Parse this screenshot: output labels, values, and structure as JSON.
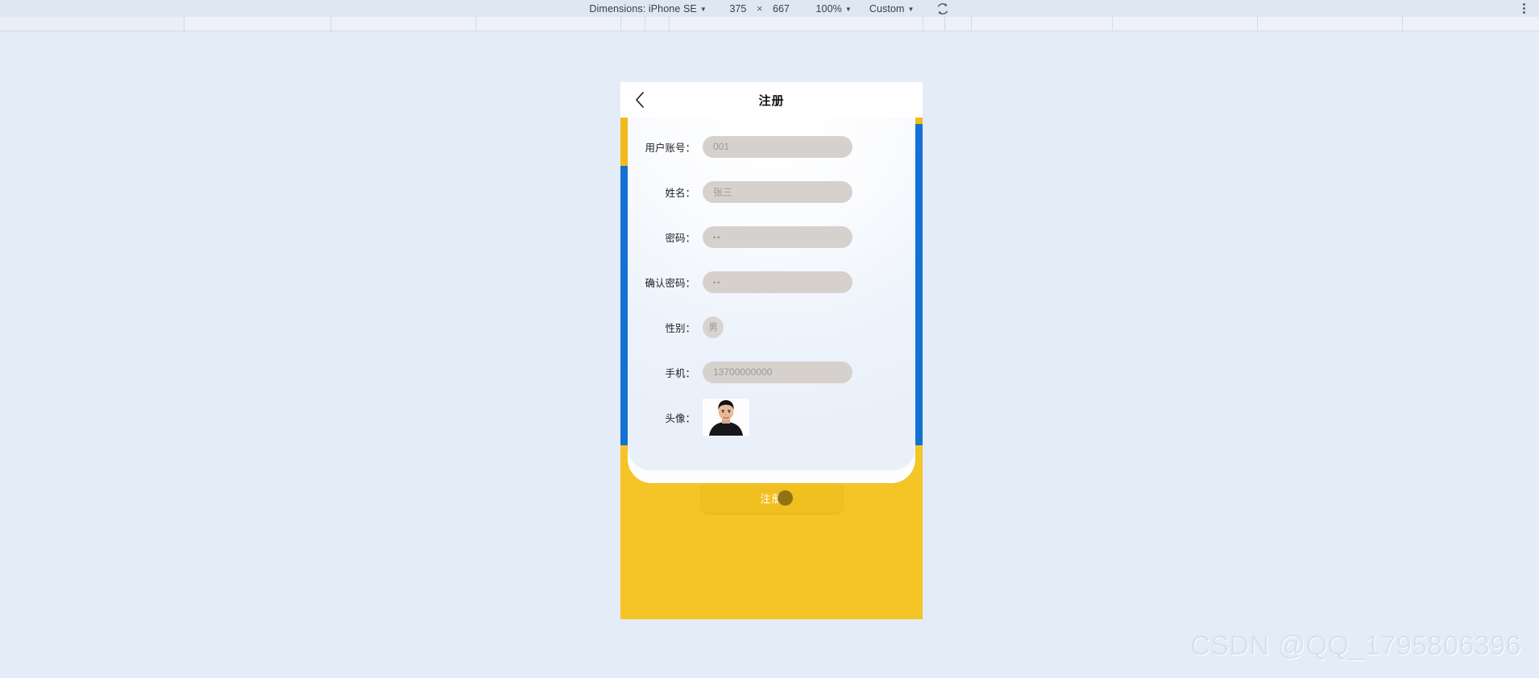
{
  "devtools_toolbar": {
    "dimensions_label": "Dimensions: iPhone SE",
    "width_value": "375",
    "times_symbol": "×",
    "height_value": "667",
    "zoom_label": "100%",
    "throttling_label": "Custom",
    "rotate_icon": "rotate-icon",
    "menu_icon": "more-vertical-icon"
  },
  "app": {
    "header": {
      "back_icon": "back-chevron-icon",
      "title": "注册"
    },
    "form": {
      "fields": [
        {
          "label": "用户账号：",
          "value": "001",
          "type": "text"
        },
        {
          "label": "姓名：",
          "value": "张三",
          "type": "text"
        },
        {
          "label": "密码：",
          "value": "••",
          "type": "password"
        },
        {
          "label": "确认密码：",
          "value": "••",
          "type": "password"
        },
        {
          "label": "性别：",
          "value": "男",
          "type": "pill"
        },
        {
          "label": "手机：",
          "value": "13700000000",
          "type": "text"
        },
        {
          "label": "头像：",
          "value": "",
          "type": "avatar"
        }
      ]
    },
    "submit": {
      "label": "注册"
    },
    "colors": {
      "brand_yellow": "#f5c426",
      "button_yellow": "#f0c020",
      "rail_blue": "#1371d4",
      "accent_yellow": "#f3ba1c",
      "input_grey": "#d6d1cd",
      "card_white": "#ffffff"
    }
  },
  "watermark": {
    "text": "CSDN @QQ_1795806396"
  }
}
